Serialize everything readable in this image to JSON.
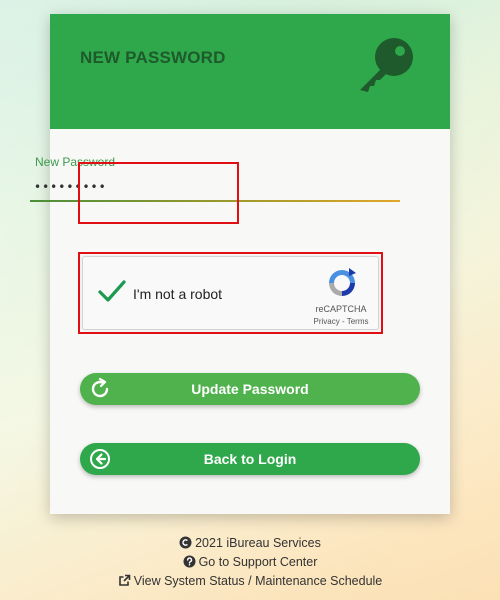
{
  "card": {
    "title": "NEW PASSWORD"
  },
  "password_field": {
    "label": "New Password",
    "value": "•••••••••"
  },
  "recaptcha": {
    "checked": true,
    "label": "I'm not a robot",
    "brand": "reCAPTCHA",
    "links": "Privacy - Terms"
  },
  "buttons": {
    "update": "Update Password",
    "back": "Back to Login"
  },
  "footer": {
    "copyright": "2021 iBureau Services",
    "support": "Go to Support Center",
    "status": "View System Status / Maintenance Schedule"
  },
  "colors": {
    "header_green": "#2ea84b",
    "title_dark_green": "#1e5a2b",
    "button_green": "#4fb24d",
    "highlight_red": "#e10f14"
  },
  "icons": [
    "key-icon",
    "check-icon",
    "recaptcha-logo-icon",
    "refresh-icon",
    "back-arrow-icon",
    "copyright-icon",
    "question-icon",
    "external-link-icon"
  ]
}
